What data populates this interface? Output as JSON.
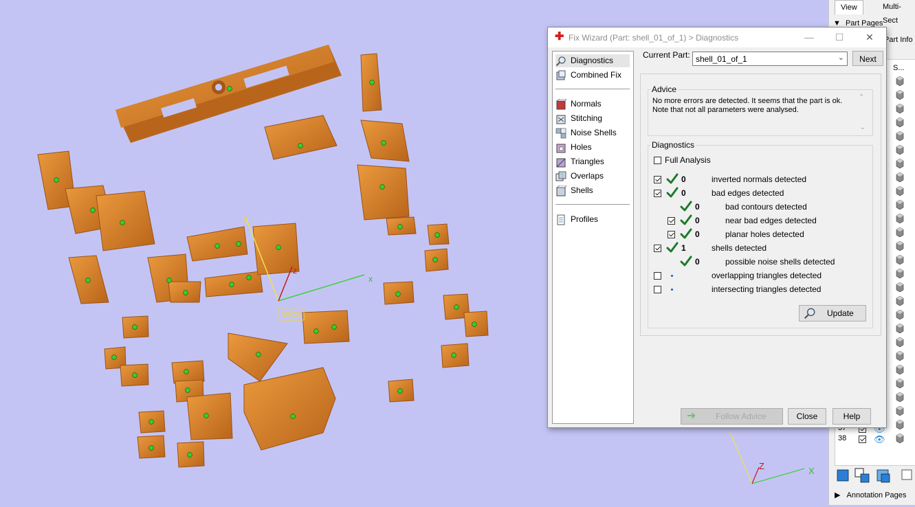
{
  "viewport": {
    "background": "#c4c4f4",
    "part_color": "#d6842a",
    "wcs_label": "WCS",
    "axis_labels": {
      "x": "x",
      "y": "y",
      "z": "z"
    },
    "corner_axis_labels": {
      "x": "X",
      "z": "Z"
    }
  },
  "right_panel": {
    "tabs": [
      "View",
      "Multi-Sect"
    ],
    "part_pages_label": "Part Pages",
    "part_info_label": "Part Info",
    "column_header": "S...",
    "rows": [
      {
        "num": "37",
        "checked": true
      },
      {
        "num": "38",
        "checked": true
      }
    ],
    "annotation_pages_label": "Annotation Pages"
  },
  "dialog": {
    "title": "Fix Wizard (Part: shell_01_of_1) > Diagnostics",
    "nav": {
      "group1": [
        {
          "label": "Diagnostics",
          "icon": "magnifier-icon",
          "selected": true
        },
        {
          "label": "Combined Fix",
          "icon": "combined-fix-icon"
        }
      ],
      "group2": [
        {
          "label": "Normals",
          "icon": "normals-icon"
        },
        {
          "label": "Stitching",
          "icon": "stitching-icon"
        },
        {
          "label": "Noise Shells",
          "icon": "noise-shells-icon"
        },
        {
          "label": "Holes",
          "icon": "holes-icon"
        },
        {
          "label": "Triangles",
          "icon": "triangles-icon"
        },
        {
          "label": "Overlaps",
          "icon": "overlaps-icon"
        },
        {
          "label": "Shells",
          "icon": "shells-icon"
        }
      ],
      "group3": [
        {
          "label": "Profiles",
          "icon": "profiles-icon"
        }
      ]
    },
    "current_part_label": "Current Part:",
    "current_part_value": "shell_01_of_1",
    "next_label": "Next",
    "advice_title": "Advice",
    "advice_text_line1": "No more errors are detected. It seems that the part is ok.",
    "advice_text_line2": "Note that not all parameters were analysed.",
    "diagnostics_title": "Diagnostics",
    "full_analysis_label": "Full Analysis",
    "full_analysis_checked": false,
    "rows": [
      {
        "checkbox": true,
        "checked": true,
        "status": "ok",
        "count": "0",
        "label": "inverted normals detected",
        "indent": 0
      },
      {
        "checkbox": true,
        "checked": true,
        "status": "ok",
        "count": "0",
        "label": "bad edges detected",
        "indent": 0
      },
      {
        "checkbox": false,
        "checked": false,
        "status": "ok",
        "count": "0",
        "label": "bad contours detected",
        "indent": 1
      },
      {
        "checkbox": true,
        "checked": true,
        "status": "ok",
        "count": "0",
        "label": "near bad edges detected",
        "indent": 1
      },
      {
        "checkbox": true,
        "checked": true,
        "status": "ok",
        "count": "0",
        "label": "planar holes detected",
        "indent": 1
      },
      {
        "checkbox": true,
        "checked": true,
        "status": "ok",
        "count": "1",
        "label": "shells detected",
        "indent": 0
      },
      {
        "checkbox": false,
        "checked": false,
        "status": "ok",
        "count": "0",
        "label": "possible noise shells detected",
        "indent": 1
      },
      {
        "checkbox": true,
        "checked": false,
        "status": "none",
        "count": "",
        "label": "overlapping triangles detected",
        "indent": 0
      },
      {
        "checkbox": true,
        "checked": false,
        "status": "none",
        "count": "",
        "label": "intersecting triangles detected",
        "indent": 0
      }
    ],
    "update_label": "Update",
    "follow_advice_label": "Follow Advice",
    "close_label": "Close",
    "help_label": "Help"
  }
}
